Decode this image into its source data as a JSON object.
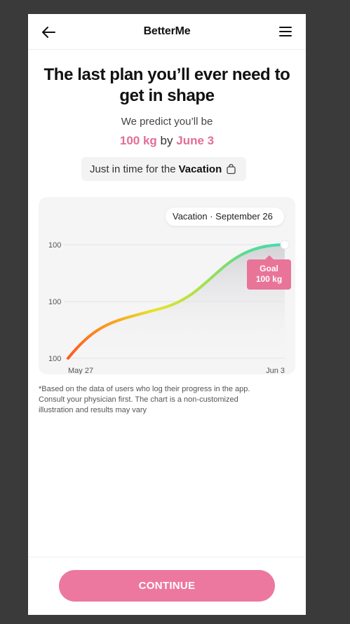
{
  "header": {
    "brand": "BetterMe",
    "back_icon": "arrow-left-icon",
    "menu_icon": "hamburger-menu-icon"
  },
  "headline": "The last plan you’ll ever need to get in shape",
  "predict_text": "We predict you’ll be",
  "result": {
    "weight": "100 kg",
    "by": "by",
    "date": "June 3"
  },
  "chip": {
    "prefix": "Just in time for the",
    "event": "Vacation",
    "icon": "shopping-bag-icon"
  },
  "chart_callout": "Vacation · September 26",
  "goal_badge": {
    "line1": "Goal",
    "line2": "100 kg"
  },
  "colors": {
    "accent": "#e26d98",
    "button": "#ec789f",
    "curve_start": "#ff5a1f",
    "curve_mid": "#e6e52a",
    "curve_end": "#3fdcb0"
  },
  "chart_data": {
    "type": "line",
    "x_labels": [
      "May 27",
      "Jun 3"
    ],
    "y_tick_labels": [
      "100",
      "100",
      "100"
    ],
    "grid": true,
    "series": [
      {
        "values": [
          0,
          0.45,
          1
        ]
      }
    ]
  },
  "disclaimer": "*Based on the data of users who log their progress in the app. Consult your physician first. The chart is a non-customized illustration and results may vary",
  "footer": {
    "continue_label": "CONTINUE"
  }
}
